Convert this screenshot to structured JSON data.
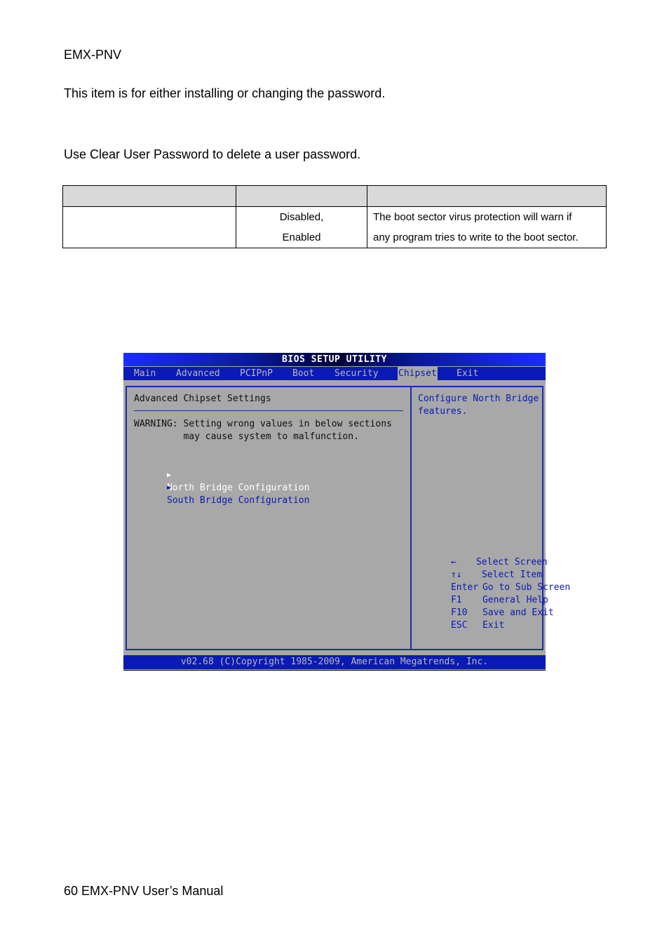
{
  "header": {
    "product": "EMX-PNV"
  },
  "paragraphs": [
    "This item is for either installing or changing the password.",
    "Use Clear User Password to delete a user password."
  ],
  "table": {
    "headers": [
      "",
      "",
      ""
    ],
    "rows": [
      {
        "col1": "",
        "col2_line1": "Disabled,",
        "col2_line2": "Enabled",
        "col3_line1": "The boot sector virus protection will warn if",
        "col3_line2": "any program tries to write to the boot sector."
      }
    ]
  },
  "bios": {
    "title": "BIOS SETUP UTILITY",
    "menu": [
      {
        "label": "Main",
        "active": false
      },
      {
        "label": "Advanced",
        "active": false
      },
      {
        "label": "PCIPnP",
        "active": false
      },
      {
        "label": "Boot",
        "active": false
      },
      {
        "label": "Security",
        "active": false
      },
      {
        "label": "Chipset",
        "active": true
      },
      {
        "label": "Exit",
        "active": false
      }
    ],
    "section_title": "Advanced Chipset Settings",
    "warning_line1": "WARNING: Setting wrong values in below sections",
    "warning_line2": "         may cause system to malfunction.",
    "items": [
      {
        "label": "North Bridge Configuration",
        "selected": true
      },
      {
        "label": "South Bridge Configuration",
        "selected": false
      }
    ],
    "submenu_arrow": "▶",
    "help_line1": "Configure North Bridge",
    "help_line2": "features.",
    "keys": [
      {
        "key": "←",
        "action": "Select Screen"
      },
      {
        "key": "↑↓",
        "action": "Select Item"
      },
      {
        "key": "Enter",
        "action": "Go to Sub Screen"
      },
      {
        "key": "F1",
        "action": "General Help"
      },
      {
        "key": "F10",
        "action": "Save and Exit"
      },
      {
        "key": "ESC",
        "action": "Exit"
      }
    ],
    "footer": "v02.68 (C)Copyright 1985-2009, American Megatrends, Inc.",
    "colors": {
      "blue": "#0a1ab4",
      "gray": "#a8a8a8",
      "selected_text": "#ffffff"
    }
  },
  "footer": {
    "page_label": "60 EMX-PNV User’s Manual"
  }
}
